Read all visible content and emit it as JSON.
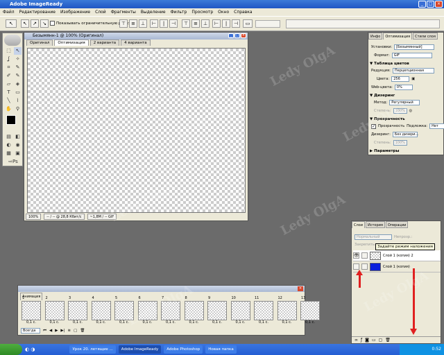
{
  "app": {
    "title": "Adobe ImageReady"
  },
  "menu": [
    "Файл",
    "Редактирование",
    "Изображение",
    "Слой",
    "Фрагменты",
    "Выделение",
    "Фильтр",
    "Просмотр",
    "Окно",
    "Справка"
  ],
  "toolbar": {
    "checkbox_label": "Показывать ограничительную рамку"
  },
  "document": {
    "title": "Безымянн-1 @ 100% (Оригинал)",
    "tabs": [
      "Оригинал",
      "Оптимизация",
      "2 варианта",
      "4 варианта"
    ],
    "status": {
      "zoom": "100%",
      "info1": "-- / -- @ 28,8 Кбит/с",
      "info2": "~1,8M / -- GIF"
    }
  },
  "optimization": {
    "tabs": [
      "Инфо",
      "Оптимизация",
      "Стили слоя"
    ],
    "settings_label": "Установки:",
    "settings_value": "[Безымянный]",
    "format_label": "Формат:",
    "format_value": "GIF",
    "color_table_section": "Таблица цветов",
    "reduction_label": "Редукция:",
    "reduction_value": "Перцепционная",
    "colors_label": "Цвета:",
    "colors_value": "256",
    "web_label": "Web-цвета:",
    "web_value": "0%",
    "dither_section": "Дизеринг",
    "method_label": "Метод:",
    "method_value": "Регулярный",
    "amount_label": "Степень:",
    "amount_value": "100%",
    "transparency_section": "Прозрачность",
    "transparency_check": "Прозрачность",
    "matte_label": "Подложка:",
    "matte_value": "Нет",
    "tdither_label": "Дизеринг:",
    "tdither_value": "Без дизери...",
    "tamount_label": "Степень:",
    "tamount_value": "100%",
    "params_section": "Параметры"
  },
  "layers_panel": {
    "tabs": [
      "Слои",
      "История",
      "Операции"
    ],
    "blend_value": "Нормальный",
    "opacity_label": "Непрозр.:",
    "lock_label": "Закрепить:",
    "tooltip": "Задайте режим наложения",
    "layers": [
      {
        "name": "Слой 1 (копия) 2",
        "color": "checker"
      },
      {
        "name": "Слой 1 (копия)",
        "color": "#0a1edc"
      }
    ]
  },
  "animation": {
    "title": "Анимация",
    "frames": [
      "1",
      "2",
      "3",
      "4",
      "5",
      "6",
      "7",
      "8",
      "9",
      "10",
      "11",
      "12",
      "13"
    ],
    "delay": "0,1 с.",
    "loop": "Всегда"
  },
  "taskbar": {
    "items": [
      "Урок 20. летящие ...",
      "Adobe ImageReady",
      "Adobe Photoshop",
      "Новая папка"
    ],
    "clock": "0:52"
  },
  "watermark": "Ledy OlgA",
  "colors": {
    "accent": "#e02020",
    "layer_blue": "#0a1edc"
  }
}
